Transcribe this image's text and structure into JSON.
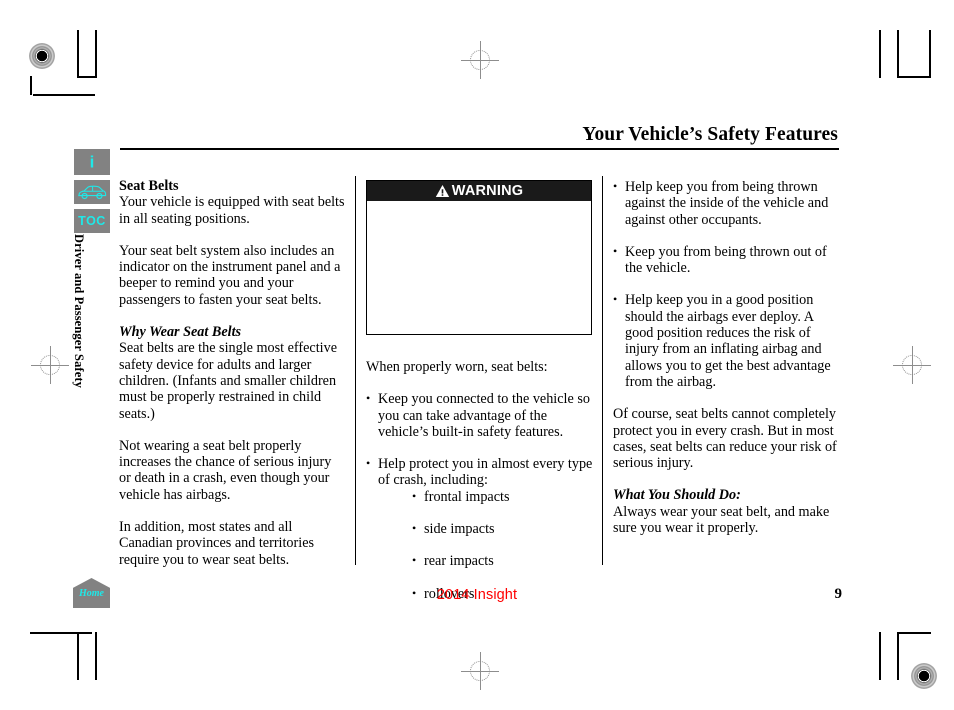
{
  "header": {
    "title": "Your Vehicle’s Safety Features"
  },
  "sidebar": {
    "icons": [
      {
        "name": "info-icon",
        "glyph": "i"
      },
      {
        "name": "vehicle-icon",
        "glyph": ""
      },
      {
        "name": "toc-icon",
        "glyph": "TOC"
      }
    ],
    "section_label": "Driver and Passenger Safety"
  },
  "column1": {
    "heading": "Seat Belts",
    "para1": "Your vehicle is equipped with seat belts in all seating positions.",
    "para2": "Your seat belt system also includes an indicator on the instrument panel and a beeper to remind you and your passengers to fasten your seat belts.",
    "subheading": "Why Wear Seat Belts",
    "para3": "Seat belts are the single most effective safety device for adults and larger children. (Infants and smaller children must be properly restrained in child seats.)",
    "para4": "Not wearing a seat belt properly increases the chance of serious injury or death in a crash, even though your vehicle has airbags.",
    "para5": "In addition, most states and all Canadian provinces and territories require you to wear seat belts."
  },
  "column2": {
    "warning": {
      "label": "WARNING",
      "icon": "warning-triangle-icon",
      "body": ""
    },
    "lead": "When properly worn, seat belts:",
    "bullets": [
      "Keep you connected to the vehicle so you can take advantage of the vehicle’s built-in safety features.",
      "Help protect you in almost every type of crash, including:"
    ],
    "sublist": [
      "frontal impacts",
      "side impacts",
      "rear impacts",
      "rollovers"
    ]
  },
  "column3": {
    "bullets": [
      "Help keep you from being thrown against the inside of the vehicle and against other occupants.",
      "Keep you from being thrown out of the vehicle.",
      "Help keep you in a good position should the airbags ever deploy. A good position reduces the risk of injury from an inflating airbag and allows you to get the best advantage from the airbag."
    ],
    "para1": "Of course, seat belts cannot completely protect you in every crash. But in most cases, seat belts can reduce your risk of serious injury.",
    "subheading": "What You Should Do:",
    "para2": "Always wear your seat belt, and make sure you wear it properly."
  },
  "footer": {
    "home_label": "Home",
    "model": "2014 Insight",
    "page_number": "9"
  },
  "colors": {
    "icon_background": "#828282",
    "icon_glyph": "#1fe8e8",
    "model_text": "#ff0000",
    "warning_header": "#1a1a1a",
    "rule": "#000000"
  }
}
